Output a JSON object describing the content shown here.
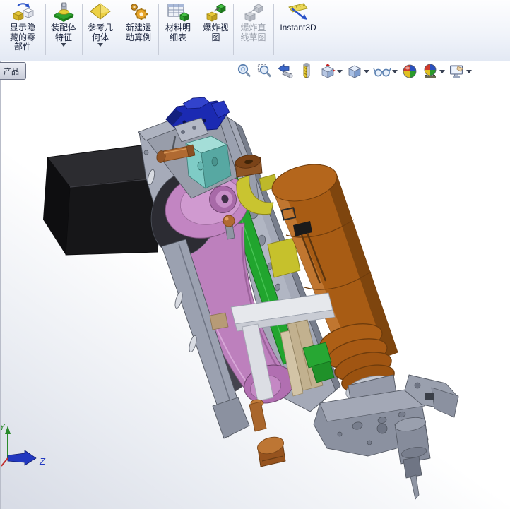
{
  "command_bar": {
    "buttons": [
      {
        "id": "show-hide-components",
        "label": "显示隐\n藏的零\n部件",
        "dropdown": false,
        "disabled": false
      },
      {
        "id": "assembly-features",
        "label": "装配体\n特征",
        "dropdown": true,
        "disabled": false
      },
      {
        "id": "reference-geometry",
        "label": "参考几\n何体",
        "dropdown": true,
        "disabled": false
      },
      {
        "id": "new-motion-study",
        "label": "新建运\n动算例",
        "dropdown": false,
        "disabled": false
      },
      {
        "id": "bill-of-materials",
        "label": "材料明\n细表",
        "dropdown": false,
        "disabled": false
      },
      {
        "id": "exploded-view",
        "label": "爆炸视\n图",
        "dropdown": false,
        "disabled": false
      },
      {
        "id": "explode-line-sketch",
        "label": "爆炸直\n线草图",
        "dropdown": false,
        "disabled": true
      },
      {
        "id": "instant3d",
        "label": "Instant3D",
        "dropdown": false,
        "disabled": false
      }
    ]
  },
  "document_tab": {
    "label": "产品"
  },
  "headsup_toolbar": {
    "items": [
      {
        "id": "zoom-to-fit",
        "dropdown": false
      },
      {
        "id": "zoom-to-area",
        "dropdown": false
      },
      {
        "id": "previous-view",
        "dropdown": false
      },
      {
        "id": "section-view",
        "dropdown": false
      },
      {
        "id": "view-orientation",
        "dropdown": true
      },
      {
        "id": "display-style",
        "dropdown": true
      },
      {
        "id": "hide-show-items",
        "dropdown": true
      },
      {
        "id": "edit-appearance",
        "dropdown": false
      },
      {
        "id": "apply-scene",
        "dropdown": true
      },
      {
        "id": "view-settings",
        "dropdown": true
      }
    ]
  },
  "viewport": {
    "triad": {
      "y_label": "Y",
      "z_label": "Z"
    },
    "model": {
      "type": "3d-assembly",
      "description": "Shaded isometric CAD assembly: belt-driven drilling spindle unit",
      "parts": [
        {
          "name": "stepper-motor",
          "color": "#1a1a1c"
        },
        {
          "name": "frame-plates",
          "color": "#a4a9b7"
        },
        {
          "name": "valve-manifold",
          "color": "#1b2ab2"
        },
        {
          "name": "slide-block",
          "color": "#7fccc6"
        },
        {
          "name": "belt-drive-pulleys",
          "color": "#c285c2"
        },
        {
          "name": "mount-plate",
          "color": "#21a52e"
        },
        {
          "name": "air-cylinder",
          "color": "#a85c14"
        },
        {
          "name": "clamp-brackets",
          "color": "#c9c430"
        },
        {
          "name": "copper-pins",
          "color": "#b06a32"
        },
        {
          "name": "guide-rail",
          "color": "#c2b18f"
        },
        {
          "name": "spindle-drill",
          "color": "#8b91a0"
        }
      ]
    }
  }
}
